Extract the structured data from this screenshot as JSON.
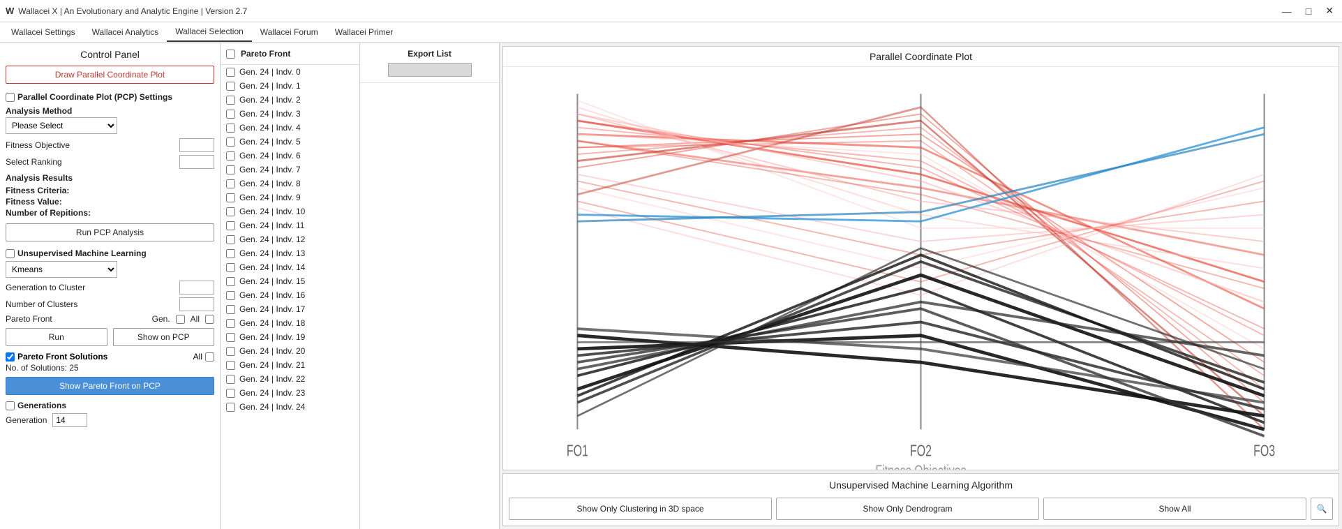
{
  "app": {
    "title": "Wallacei X  |  An Evolutionary and Analytic Engine  |  Version 2.7",
    "icon": "W"
  },
  "titlebar": {
    "minimize": "—",
    "maximize": "□",
    "close": "✕"
  },
  "menu": {
    "items": [
      {
        "label": "Wallacei Settings",
        "active": false
      },
      {
        "label": "Wallacei Analytics",
        "active": false
      },
      {
        "label": "Wallacei Selection",
        "active": true
      },
      {
        "label": "Wallacei Forum",
        "active": false
      },
      {
        "label": "Wallacei Primer",
        "active": false
      }
    ]
  },
  "control_panel": {
    "title": "Control Panel",
    "draw_btn": "Draw Parallel Coordinate Plot",
    "pcp_settings_label": "Parallel Coordinate Plot (PCP) Settings",
    "analysis_method_label": "Analysis Method",
    "analysis_method_placeholder": "Please Select",
    "fitness_objective_label": "Fitness Objective",
    "select_ranking_label": "Select Ranking",
    "analysis_results_label": "Analysis Results",
    "fitness_criteria_label": "Fitness Criteria:",
    "fitness_value_label": "Fitness Value:",
    "num_repetitions_label": "Number of Repitions:",
    "run_pcp_btn": "Run PCP Analysis",
    "unsupervised_ml_label": "Unsupervised Machine Learning",
    "kmeans_option": "Kmeans",
    "gen_to_cluster_label": "Generation to Cluster",
    "num_clusters_label": "Number of Clusters",
    "pareto_front_label": "Pareto Front",
    "gen_label": "Gen.",
    "all_label": "All",
    "run_btn": "Run",
    "show_on_pcp_btn": "Show on PCP",
    "pareto_front_solutions_label": "Pareto Front Solutions",
    "all_checkbox_label": "All",
    "no_of_solutions": "No. of Solutions: 25",
    "show_pareto_btn": "Show Pareto Front on PCP",
    "generations_label": "Generations",
    "generation_label": "Generation",
    "generation_value": "14"
  },
  "pareto_list": {
    "title": "Pareto Front",
    "items": [
      "Gen. 24 | Indv. 0",
      "Gen. 24 | Indv. 1",
      "Gen. 24 | Indv. 2",
      "Gen. 24 | Indv. 3",
      "Gen. 24 | Indv. 4",
      "Gen. 24 | Indv. 5",
      "Gen. 24 | Indv. 6",
      "Gen. 24 | Indv. 7",
      "Gen. 24 | Indv. 8",
      "Gen. 24 | Indv. 9",
      "Gen. 24 | Indv. 10",
      "Gen. 24 | Indv. 11",
      "Gen. 24 | Indv. 12",
      "Gen. 24 | Indv. 13",
      "Gen. 24 | Indv. 14",
      "Gen. 24 | Indv. 15",
      "Gen. 24 | Indv. 16",
      "Gen. 24 | Indv. 17",
      "Gen. 24 | Indv. 18",
      "Gen. 24 | Indv. 19",
      "Gen. 24 | Indv. 20",
      "Gen. 24 | Indv. 21",
      "Gen. 24 | Indv. 22",
      "Gen. 24 | Indv. 23",
      "Gen. 24 | Indv. 24"
    ]
  },
  "export_list": {
    "title": "Export List"
  },
  "pcp_chart": {
    "title": "Parallel Coordinate Plot",
    "x_axis_label": "Fitness Objectives",
    "axes": [
      "FO1",
      "FO2",
      "FO3"
    ]
  },
  "ml_panel": {
    "title": "Unsupervised Machine Learning Algorithm",
    "btn1": "Show Only Clustering in 3D space",
    "btn2": "Show Only Dendrogram",
    "btn3": "Show All",
    "icon": "🔍"
  }
}
